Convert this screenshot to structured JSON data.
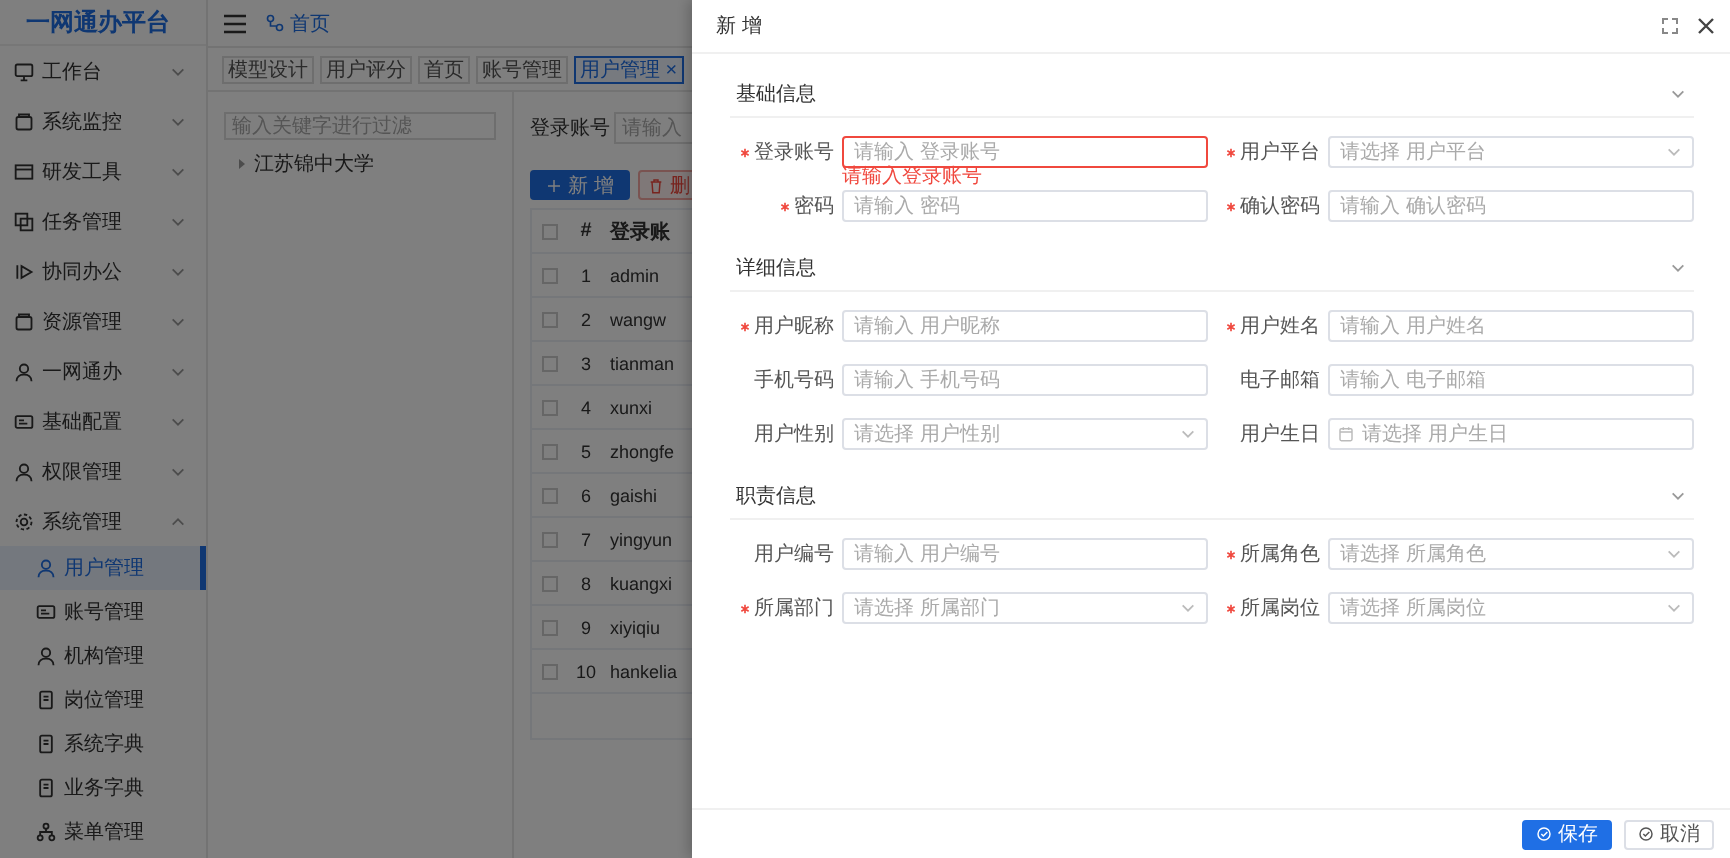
{
  "sidebar": {
    "logo": "一网通办平台",
    "items": [
      {
        "label": "工作台",
        "expanded": false
      },
      {
        "label": "系统监控",
        "expanded": false
      },
      {
        "label": "研发工具",
        "expanded": false
      },
      {
        "label": "任务管理",
        "expanded": false
      },
      {
        "label": "协同办公",
        "expanded": false
      },
      {
        "label": "资源管理",
        "expanded": false
      },
      {
        "label": "一网通办",
        "expanded": false
      },
      {
        "label": "基础配置",
        "expanded": false
      },
      {
        "label": "权限管理",
        "expanded": false
      },
      {
        "label": "系统管理",
        "expanded": true,
        "children": [
          {
            "label": "用户管理",
            "selected": true
          },
          {
            "label": "账号管理",
            "selected": false
          },
          {
            "label": "机构管理",
            "selected": false
          },
          {
            "label": "岗位管理",
            "selected": false
          },
          {
            "label": "系统字典",
            "selected": false
          },
          {
            "label": "业务字典",
            "selected": false
          },
          {
            "label": "菜单管理",
            "selected": false
          }
        ]
      }
    ]
  },
  "header": {
    "breadcrumb": "首页"
  },
  "tabs": [
    {
      "label": "模型设计",
      "selected": false
    },
    {
      "label": "用户评分",
      "selected": false
    },
    {
      "label": "首页",
      "selected": false
    },
    {
      "label": "账号管理",
      "selected": false
    },
    {
      "label": "用户管理",
      "selected": true,
      "close": "×"
    }
  ],
  "tree": {
    "filter_placeholder": "输入关键字进行过滤",
    "nodes": [
      {
        "label": "江苏锦中大学",
        "expanded": false
      }
    ]
  },
  "search": {
    "label": "登录账号",
    "placeholder": "请输入"
  },
  "toolbar": [
    {
      "label": "新 增",
      "kind": "primary"
    },
    {
      "label": "删",
      "kind": "danger"
    }
  ],
  "table": {
    "all_checked": false,
    "columns": [
      "#",
      "登录账"
    ],
    "rows": [
      {
        "checked": false,
        "index": "1",
        "account": "admin"
      },
      {
        "checked": false,
        "index": "2",
        "account": "wangw"
      },
      {
        "checked": false,
        "index": "3",
        "account": "tianman"
      },
      {
        "checked": false,
        "index": "4",
        "account": "xunxi"
      },
      {
        "checked": false,
        "index": "5",
        "account": "zhongfe"
      },
      {
        "checked": false,
        "index": "6",
        "account": "gaishi"
      },
      {
        "checked": false,
        "index": "7",
        "account": "yingyun"
      },
      {
        "checked": false,
        "index": "8",
        "account": "kuangxi"
      },
      {
        "checked": false,
        "index": "9",
        "account": "xiyiqiu"
      },
      {
        "checked": false,
        "index": "10",
        "account": "hankelia"
      }
    ]
  },
  "drawer": {
    "title": "新 增",
    "sections": [
      {
        "title": "基础信息",
        "expanded": true,
        "fields": [
          {
            "label": "登录账号",
            "required": true,
            "kind": "input",
            "placeholder": "请输入 登录账号",
            "error": "请输入登录账号"
          },
          {
            "label": "用户平台",
            "required": true,
            "kind": "select",
            "placeholder": "请选择 用户平台"
          },
          {
            "label": "密码",
            "required": true,
            "kind": "input",
            "placeholder": "请输入 密码"
          },
          {
            "label": "确认密码",
            "required": true,
            "kind": "input",
            "placeholder": "请输入 确认密码"
          }
        ]
      },
      {
        "title": "详细信息",
        "expanded": true,
        "fields": [
          {
            "label": "用户昵称",
            "required": true,
            "kind": "input",
            "placeholder": "请输入 用户昵称"
          },
          {
            "label": "用户姓名",
            "required": true,
            "kind": "input",
            "placeholder": "请输入 用户姓名"
          },
          {
            "label": "手机号码",
            "required": false,
            "kind": "input",
            "placeholder": "请输入 手机号码"
          },
          {
            "label": "电子邮箱",
            "required": false,
            "kind": "input",
            "placeholder": "请输入 电子邮箱"
          },
          {
            "label": "用户性别",
            "required": false,
            "kind": "select",
            "placeholder": "请选择 用户性别"
          },
          {
            "label": "用户生日",
            "required": false,
            "kind": "date",
            "placeholder": "请选择 用户生日"
          }
        ]
      },
      {
        "title": "职责信息",
        "expanded": true,
        "fields": [
          {
            "label": "用户编号",
            "required": false,
            "kind": "input",
            "placeholder": "请输入 用户编号"
          },
          {
            "label": "所属角色",
            "required": true,
            "kind": "select",
            "placeholder": "请选择 所属角色"
          },
          {
            "label": "所属部门",
            "required": true,
            "kind": "select",
            "placeholder": "请选择 所属部门"
          },
          {
            "label": "所属岗位",
            "required": true,
            "kind": "select",
            "placeholder": "请选择 所属岗位"
          }
        ]
      }
    ],
    "buttons": [
      {
        "label": "保存",
        "kind": "primary"
      },
      {
        "label": "取消",
        "kind": "default"
      }
    ]
  }
}
